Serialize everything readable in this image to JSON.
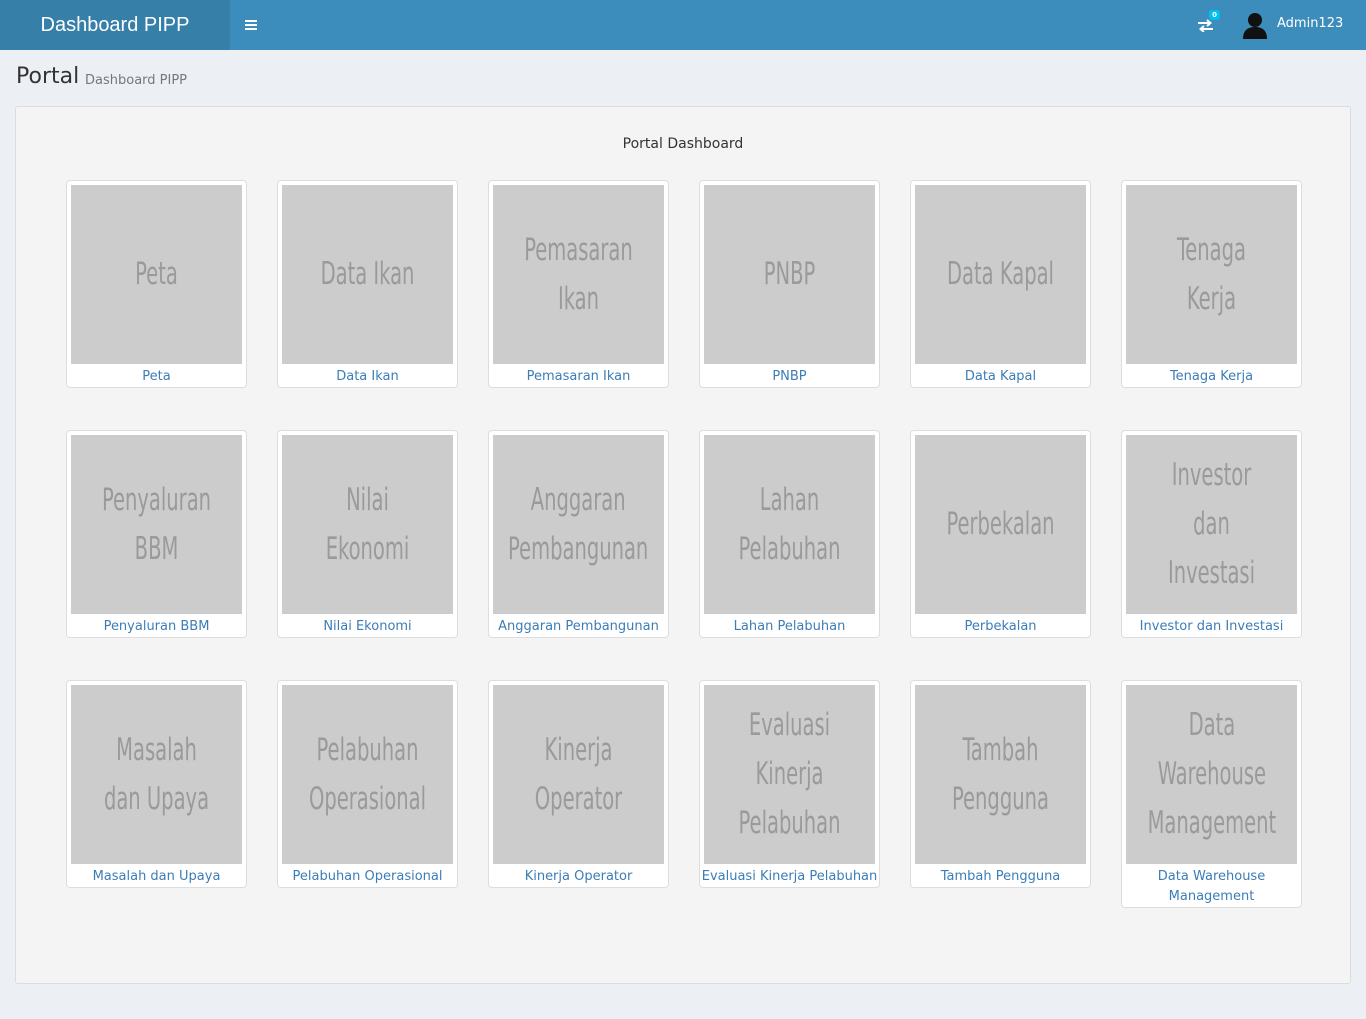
{
  "header": {
    "brand": "Dashboard PIPP",
    "notification_count": "0",
    "username": "Admin123"
  },
  "page": {
    "title": "Portal",
    "subtitle": "Dashboard PIPP"
  },
  "portal": {
    "title": "Portal Dashboard",
    "tiles": [
      {
        "image_text": "Peta",
        "label": "Peta"
      },
      {
        "image_text": "Data Ikan",
        "label": "Data Ikan"
      },
      {
        "image_text": "Pemasaran Ikan",
        "label": "Pemasaran Ikan"
      },
      {
        "image_text": "PNBP",
        "label": "PNBP"
      },
      {
        "image_text": "Data Kapal",
        "label": "Data Kapal"
      },
      {
        "image_text": "Tenaga Kerja",
        "label": "Tenaga Kerja"
      },
      {
        "image_text": "Penyaluran BBM",
        "label": "Penyaluran BBM"
      },
      {
        "image_text": "Nilai Ekonomi",
        "label": "Nilai Ekonomi"
      },
      {
        "image_text": "Anggaran Pembangunan",
        "label": "Anggaran Pembangunan"
      },
      {
        "image_text": "Lahan Pelabuhan",
        "label": "Lahan Pelabuhan"
      },
      {
        "image_text": "Perbekalan",
        "label": "Perbekalan"
      },
      {
        "image_text": "Investor dan Investasi",
        "label": "Investor dan Investasi"
      },
      {
        "image_text": "Masalah dan Upaya",
        "label": "Masalah dan Upaya"
      },
      {
        "image_text": "Pelabuhan Operasional",
        "label": "Pelabuhan Operasional"
      },
      {
        "image_text": "Kinerja Operator",
        "label": "Kinerja Operator"
      },
      {
        "image_text": "Evaluasi Kinerja Pelabuhan",
        "label": "Evaluasi Kinerja Pelabuhan"
      },
      {
        "image_text": "Tambah Pengguna",
        "label": "Tambah Pengguna"
      },
      {
        "image_text": "Data Warehouse Management",
        "label": "Data Warehouse Management"
      }
    ]
  },
  "icons": {
    "menu": "hamburger-menu-icon",
    "notifications": "exchange-arrows-icon",
    "user": "user-avatar-icon"
  },
  "colors": {
    "header": "#3c8dbc",
    "brand_bg": "#367fa9",
    "badge": "#00c0ef",
    "link": "#3c7db6",
    "thumb_bg": "#cccccc"
  }
}
